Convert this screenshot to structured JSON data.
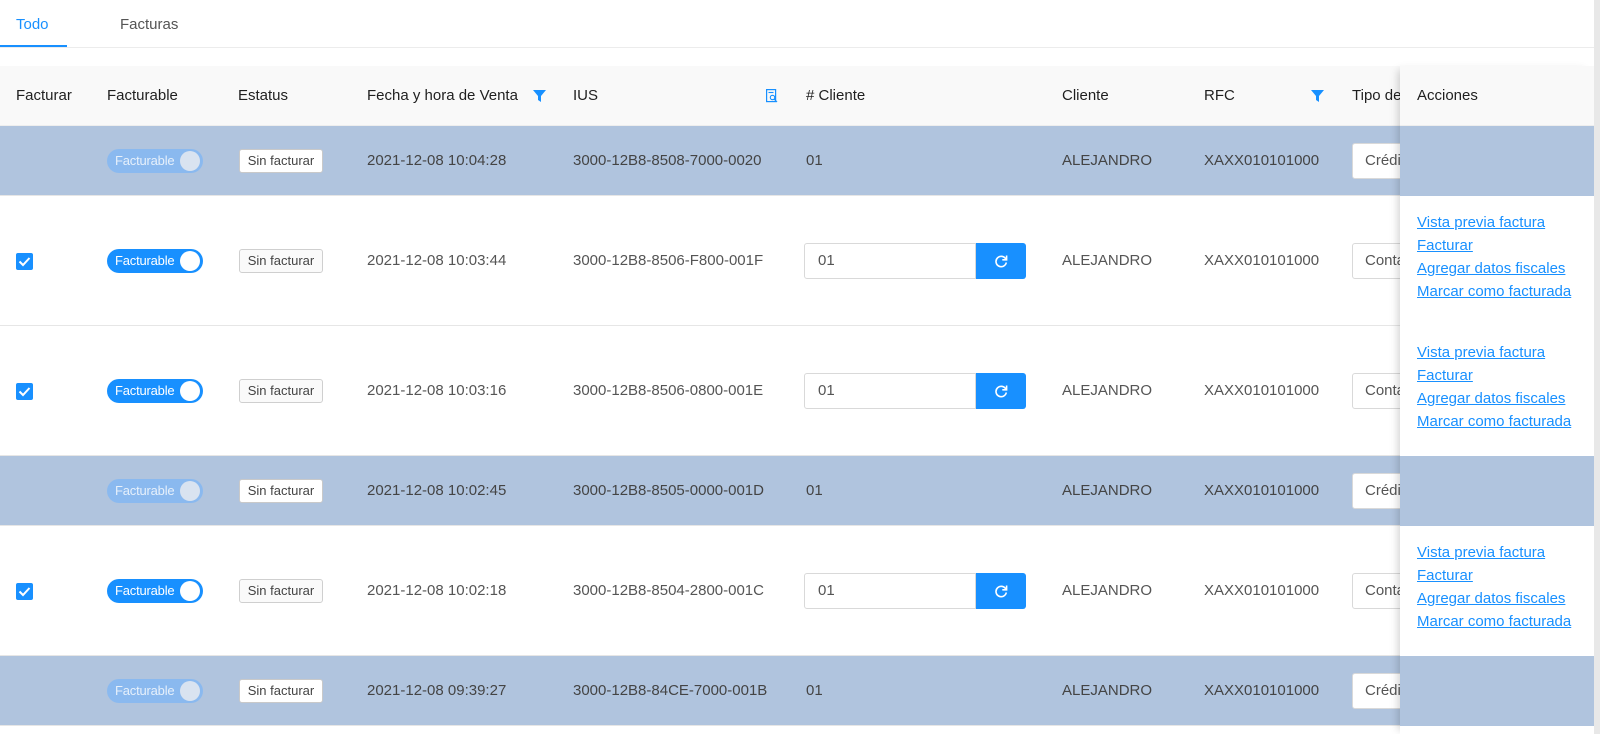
{
  "tabs": [
    {
      "label": "Todo",
      "active": true
    },
    {
      "label": "Facturas",
      "active": false
    }
  ],
  "columns": {
    "facturar": "Facturar",
    "facturable": "Facturable",
    "estatus": "Estatus",
    "fecha": "Fecha y hora de Venta",
    "ius": "IUS",
    "num_cliente": "# Cliente",
    "cliente": "Cliente",
    "rfc": "RFC",
    "tipo": "Tipo de",
    "acciones": "Acciones"
  },
  "actions": {
    "preview": "Vista previa factura",
    "facturar": "Facturar",
    "fiscal": "Agregar datos fiscales",
    "mark": "Marcar como facturada"
  },
  "rows": [
    {
      "checked": false,
      "facturable": "Facturable",
      "enabled": false,
      "estatus": "Sin facturar",
      "fecha": "2021-12-08 10:04:28",
      "ius": "3000-12B8-8508-7000-0020",
      "num_cliente": "01",
      "cliente": "ALEJANDRO",
      "rfc": "XAXX010101000",
      "tipo": "Crédi"
    },
    {
      "checked": true,
      "facturable": "Facturable",
      "enabled": true,
      "estatus": "Sin facturar",
      "fecha": "2021-12-08 10:03:44",
      "ius": "3000-12B8-8506-F800-001F",
      "num_cliente": "01",
      "cliente": "ALEJANDRO",
      "rfc": "XAXX010101000",
      "tipo": "Conta"
    },
    {
      "checked": true,
      "facturable": "Facturable",
      "enabled": true,
      "estatus": "Sin facturar",
      "fecha": "2021-12-08 10:03:16",
      "ius": "3000-12B8-8506-0800-001E",
      "num_cliente": "01",
      "cliente": "ALEJANDRO",
      "rfc": "XAXX010101000",
      "tipo": "Conta"
    },
    {
      "checked": false,
      "facturable": "Facturable",
      "enabled": false,
      "estatus": "Sin facturar",
      "fecha": "2021-12-08 10:02:45",
      "ius": "3000-12B8-8505-0000-001D",
      "num_cliente": "01",
      "cliente": "ALEJANDRO",
      "rfc": "XAXX010101000",
      "tipo": "Crédi"
    },
    {
      "checked": true,
      "facturable": "Facturable",
      "enabled": true,
      "estatus": "Sin facturar",
      "fecha": "2021-12-08 10:02:18",
      "ius": "3000-12B8-8504-2800-001C",
      "num_cliente": "01",
      "cliente": "ALEJANDRO",
      "rfc": "XAXX010101000",
      "tipo": "Conta"
    },
    {
      "checked": false,
      "facturable": "Facturable",
      "enabled": false,
      "estatus": "Sin facturar",
      "fecha": "2021-12-08 09:39:27",
      "ius": "3000-12B8-84CE-7000-001B",
      "num_cliente": "01",
      "cliente": "ALEJANDRO",
      "rfc": "XAXX010101000",
      "tipo": "Crédi"
    }
  ],
  "colors": {
    "accent": "#1890ff",
    "disabled_row": "#b0c4de"
  }
}
